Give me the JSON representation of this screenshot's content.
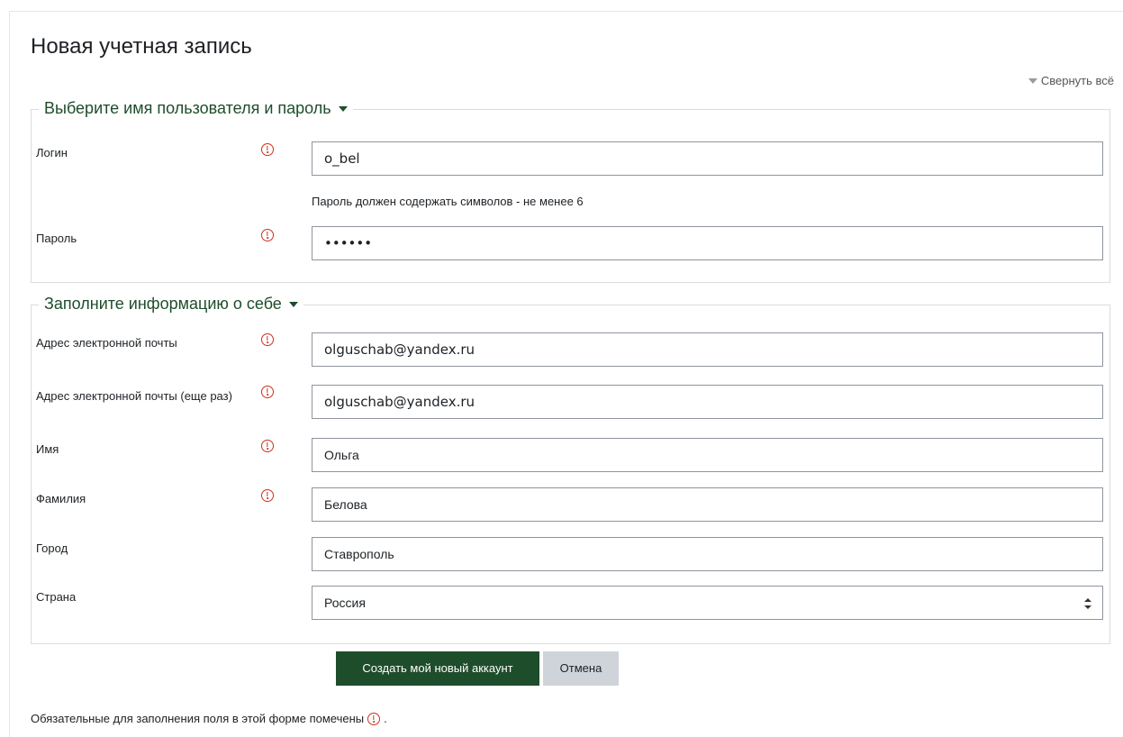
{
  "page": {
    "title": "Новая учетная запись",
    "collapse_all": "Свернуть всё"
  },
  "colors": {
    "brand": "#1e4d2b",
    "required_icon": "#ca3120",
    "secondary_button": "#ced4da"
  },
  "section_credentials": {
    "legend": "Выберите имя пользователя и пароль",
    "username_label": "Логин",
    "username_value": "o_bel",
    "password_hint": "Пароль должен содержать символов - не менее 6",
    "password_label": "Пароль",
    "password_value": "••••••"
  },
  "section_profile": {
    "legend": "Заполните информацию о себе",
    "email_label": "Адрес электронной почты",
    "email_value": "olguschab@yandex.ru",
    "email2_label": "Адрес электронной почты (еще раз)",
    "email2_value": "olguschab@yandex.ru",
    "firstname_label": "Имя",
    "firstname_value": "Ольга",
    "lastname_label": "Фамилия",
    "lastname_value": "Белова",
    "city_label": "Город",
    "city_value": "Ставрополь",
    "country_label": "Страна",
    "country_value": "Россия"
  },
  "actions": {
    "submit_label": "Создать мой новый аккаунт",
    "cancel_label": "Отмена"
  },
  "footnote": {
    "text": "Обязательные для заполнения поля в этой форме помечены",
    "suffix": "."
  },
  "icons": {
    "required": "required-exclamation-circle-icon",
    "collapse": "triangle-down-icon",
    "select": "up-down-arrows-icon"
  }
}
